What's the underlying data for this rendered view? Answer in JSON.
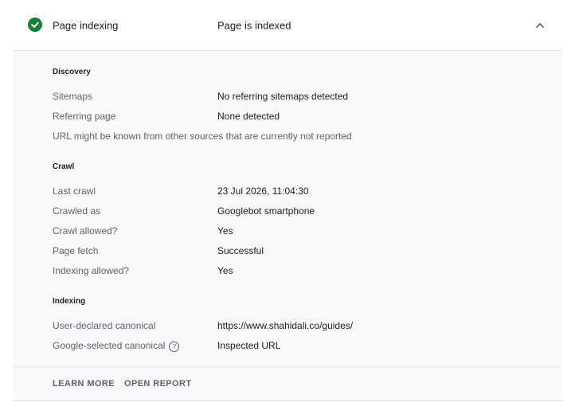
{
  "header": {
    "status_icon": "check-circle-icon",
    "status_color": "#188038",
    "label": "Page indexing",
    "value": "Page is indexed",
    "toggle_icon": "chevron-up-icon"
  },
  "discovery": {
    "heading": "Discovery",
    "rows": [
      {
        "label": "Sitemaps",
        "value": "No referring sitemaps detected"
      },
      {
        "label": "Referring page",
        "value": "None detected"
      }
    ],
    "note": "URL might be known from other sources that are currently not reported"
  },
  "crawl": {
    "heading": "Crawl",
    "rows": [
      {
        "label": "Last crawl",
        "value": "23 Jul 2026, 11:04:30"
      },
      {
        "label": "Crawled as",
        "value": "Googlebot smartphone"
      },
      {
        "label": "Crawl allowed?",
        "value": "Yes"
      },
      {
        "label": "Page fetch",
        "value": "Successful"
      },
      {
        "label": "Indexing allowed?",
        "value": "Yes"
      }
    ]
  },
  "indexing": {
    "heading": "Indexing",
    "rows": [
      {
        "label": "User-declared canonical",
        "value": "https://www.shahidali.co/guides/"
      },
      {
        "label": "Google-selected canonical",
        "value": "Inspected URL",
        "help_icon": "help-circle-icon"
      }
    ]
  },
  "footer": {
    "learn_more": "LEARN MORE",
    "open_report": "OPEN REPORT"
  }
}
